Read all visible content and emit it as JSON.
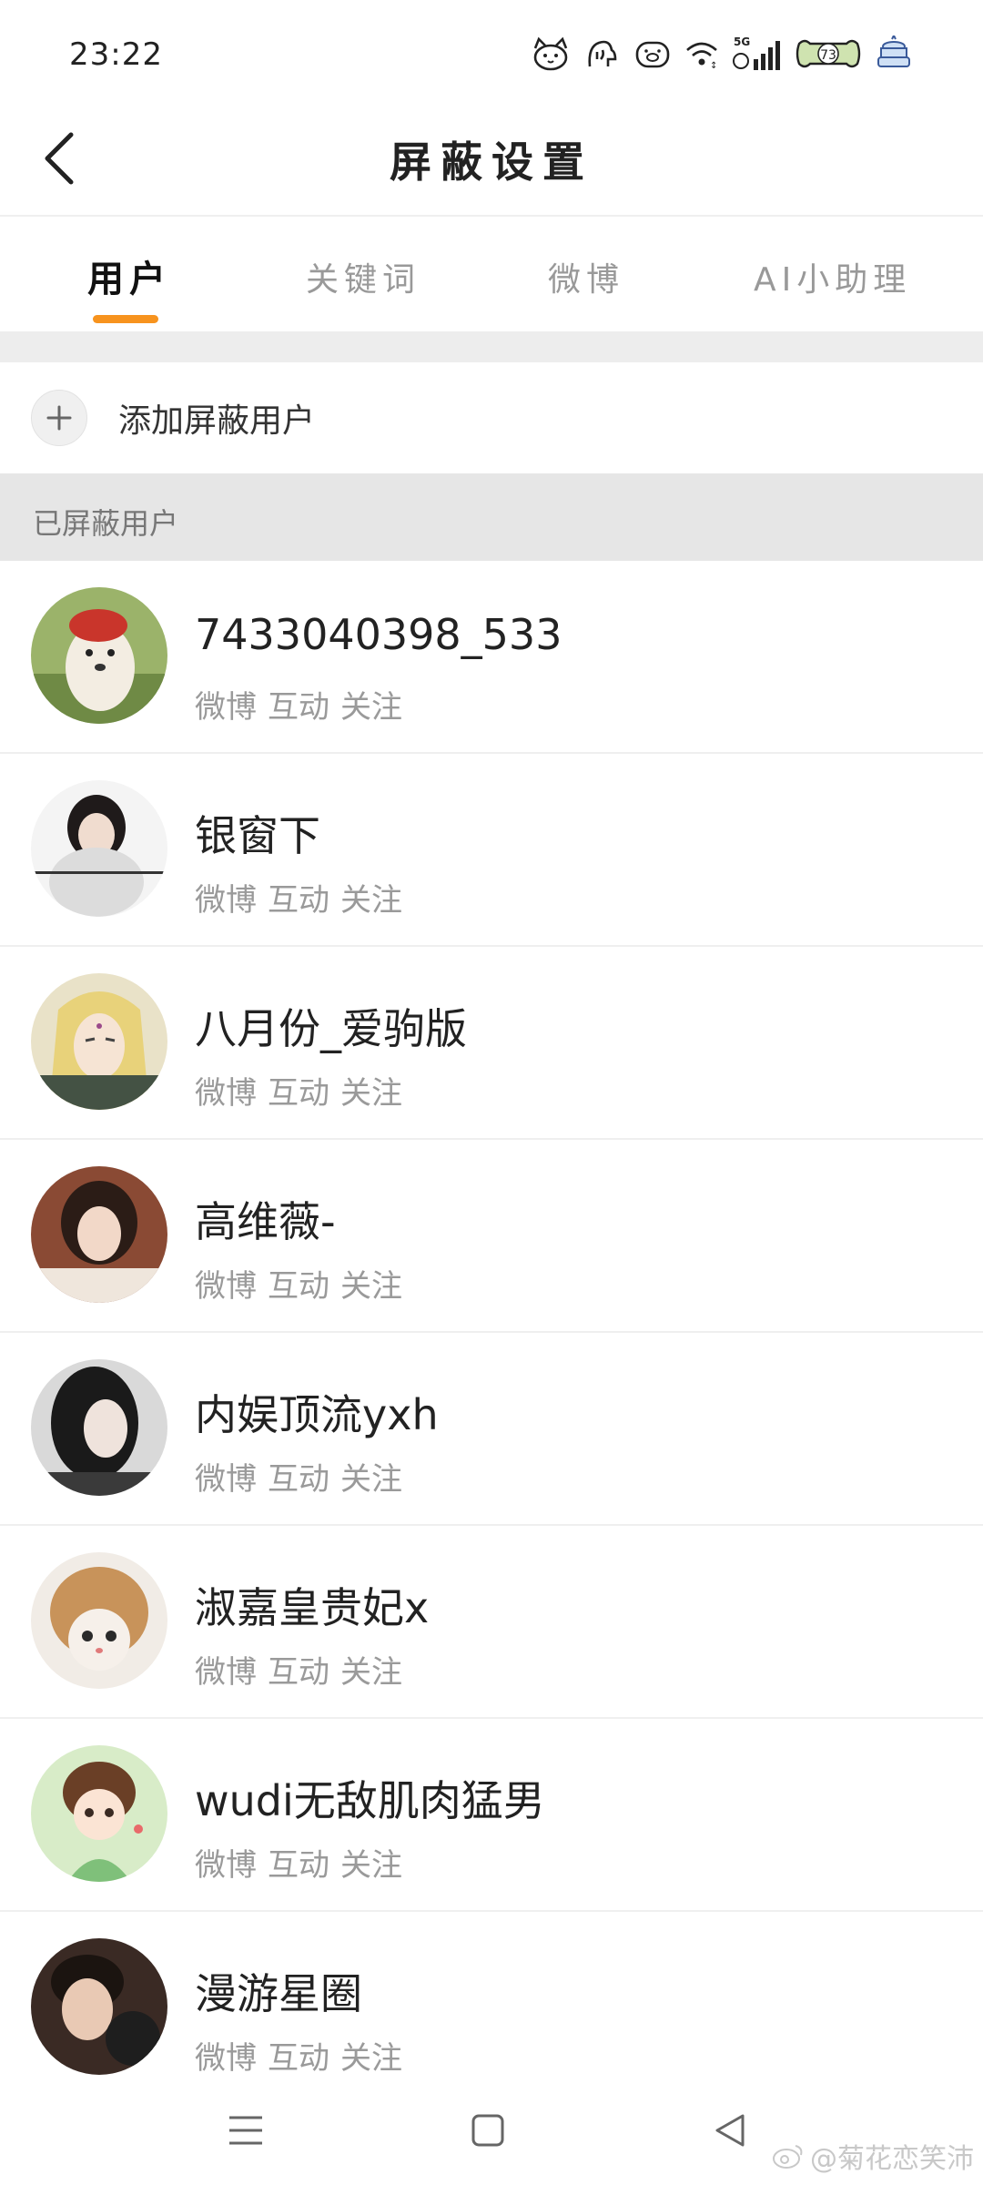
{
  "status_bar": {
    "time": "23:22",
    "network": "5G",
    "battery": "73",
    "icons": [
      "cat-face-icon",
      "animal-doodle-icon",
      "pig-face-icon",
      "wifi-icon",
      "signal-icon",
      "battery-icon",
      "cake-icon"
    ]
  },
  "header": {
    "title": "屏蔽设置",
    "back_icon": "chevron-left-icon"
  },
  "tabs": [
    {
      "label": "用户",
      "active": true
    },
    {
      "label": "关键词",
      "active": false
    },
    {
      "label": "微博",
      "active": false
    },
    {
      "label": "AI小助理",
      "active": false
    }
  ],
  "add_row": {
    "label": "添加屏蔽用户",
    "icon": "plus-icon"
  },
  "section": {
    "title": "已屏蔽用户"
  },
  "users": [
    {
      "name": "7433040398_533",
      "tags": [
        "微博",
        "互动",
        "关注"
      ]
    },
    {
      "name": "银窗下",
      "tags": [
        "微博",
        "互动",
        "关注"
      ]
    },
    {
      "name": "八月份_爱驹版",
      "tags": [
        "微博",
        "互动",
        "关注"
      ]
    },
    {
      "name": "高维薇-",
      "tags": [
        "微博",
        "互动",
        "关注"
      ]
    },
    {
      "name": "内娱顶流yxh",
      "tags": [
        "微博",
        "互动",
        "关注"
      ]
    },
    {
      "name": "淑嘉皇贵妃x",
      "tags": [
        "微博",
        "互动",
        "关注"
      ]
    },
    {
      "name": "wudi无敌肌肉猛男",
      "tags": [
        "微博",
        "互动",
        "关注"
      ]
    },
    {
      "name": "漫游星圈",
      "tags": [
        "微博",
        "互动",
        "关注"
      ]
    }
  ],
  "nav_bar": {
    "icons": [
      "menu-icon",
      "home-square-icon",
      "back-triangle-icon"
    ]
  },
  "watermark": {
    "text": "@菊花恋笑沛"
  },
  "colors": {
    "accent": "#f7931e",
    "section_bg": "#e6e6e6",
    "muted_text": "#9a9a9a"
  }
}
